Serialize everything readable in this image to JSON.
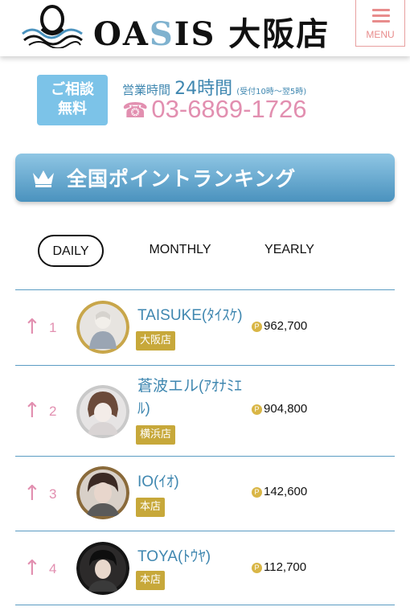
{
  "header": {
    "logo_text_left": "OA",
    "logo_text_s": "S",
    "logo_text_right": "IS 大阪店",
    "menu_label": "MENU"
  },
  "contact": {
    "consult_line1": "ご相談",
    "consult_line2": "無料",
    "hours_label": "営業時間",
    "hours_value": "24時間",
    "hours_note": "(受付10時～翌5時)",
    "phone": "03-6869-1726"
  },
  "banner": {
    "title": "全国ポイントランキング"
  },
  "tabs": [
    {
      "label": "DAILY",
      "active": true
    },
    {
      "label": "MONTHLY",
      "active": false
    },
    {
      "label": "YEARLY",
      "active": false
    }
  ],
  "ranking": [
    {
      "rank": "1",
      "name": "TAISUKE(ﾀｲｽｹ)",
      "shop": "大阪店",
      "points": "962,700",
      "trend": "up"
    },
    {
      "rank": "2",
      "name": "蒼波エル(ｱｵﾅﾐｴﾙ)",
      "shop": "横浜店",
      "points": "904,800",
      "trend": "up"
    },
    {
      "rank": "3",
      "name": "IO(ｲｵ)",
      "shop": "本店",
      "points": "142,600",
      "trend": "up"
    },
    {
      "rank": "4",
      "name": "TOYA(ﾄｳﾔ)",
      "shop": "本店",
      "points": "112,700",
      "trend": "up"
    }
  ],
  "colors": {
    "accent_blue": "#3f87b0",
    "accent_pink": "#e28fb0",
    "shop_badge": "#c7a83a",
    "banner_top": "#8fc6e4",
    "banner_bottom": "#4a92be"
  },
  "icons": {
    "menu": "hamburger-icon",
    "phone": "phone-icon",
    "crown": "crown-icon",
    "trend": "arrow-up-icon",
    "points": "point-coin-icon"
  }
}
